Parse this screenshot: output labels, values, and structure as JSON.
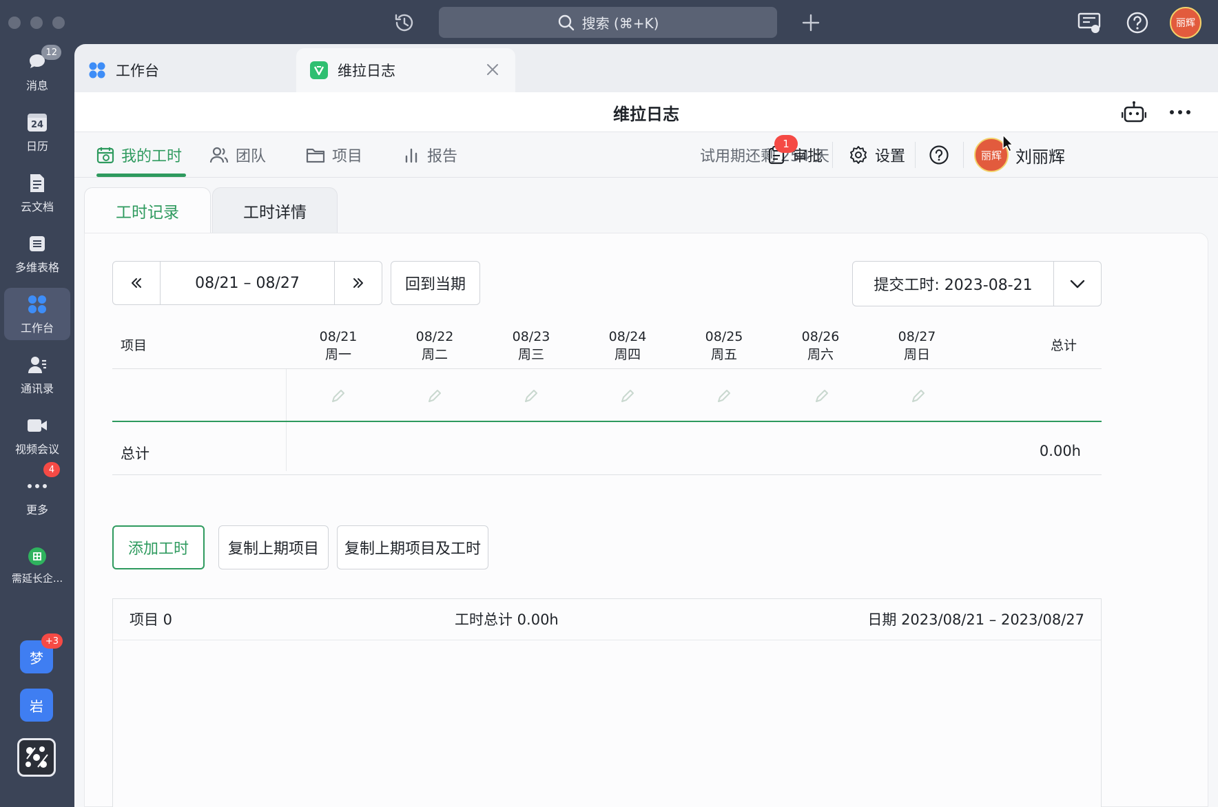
{
  "titlebar": {
    "search_placeholder": "搜索 (⌘+K)",
    "avatar_text": "丽辉"
  },
  "sidebar": {
    "items": [
      {
        "label": "消息",
        "badge": "12"
      },
      {
        "label": "日历",
        "icon_text": "24"
      },
      {
        "label": "云文档"
      },
      {
        "label": "多维表格"
      },
      {
        "label": "工作台"
      },
      {
        "label": "通讯录"
      },
      {
        "label": "视频会议"
      },
      {
        "label": "更多",
        "badge": "4"
      },
      {
        "label": "需延长企..."
      }
    ],
    "apps": [
      {
        "label": "梦",
        "badge": "+3"
      },
      {
        "label": "岩"
      }
    ]
  },
  "tabs": [
    {
      "label": "工作台"
    },
    {
      "label": "维拉日志"
    }
  ],
  "header": {
    "title": "维拉日志"
  },
  "nav": {
    "items": [
      {
        "label": "我的工时"
      },
      {
        "label": "团队"
      },
      {
        "label": "项目"
      },
      {
        "label": "报告"
      }
    ],
    "trial_text": "试用期还剩 254 天",
    "approval_label": "审批",
    "approval_badge": "1",
    "settings_label": "设置",
    "user_avatar_text": "丽辉",
    "user_name": "刘丽辉"
  },
  "subtabs": [
    {
      "label": "工时记录"
    },
    {
      "label": "工时详情"
    }
  ],
  "controls": {
    "range": "08/21 – 08/27",
    "back_to_current": "回到当期",
    "submit": "提交工时: 2023-08-21"
  },
  "table": {
    "project_header": "项目",
    "days": [
      {
        "date": "08/21",
        "weekday": "周一"
      },
      {
        "date": "08/22",
        "weekday": "周二"
      },
      {
        "date": "08/23",
        "weekday": "周三"
      },
      {
        "date": "08/24",
        "weekday": "周四"
      },
      {
        "date": "08/25",
        "weekday": "周五"
      },
      {
        "date": "08/26",
        "weekday": "周六"
      },
      {
        "date": "08/27",
        "weekday": "周日"
      }
    ],
    "total_header": "总计",
    "total_label": "总计",
    "total_value": "0.00h"
  },
  "actions": {
    "add": "添加工时",
    "copy_projects": "复制上期项目",
    "copy_projects_hours": "复制上期项目及工时"
  },
  "summary": {
    "projects": "项目 0",
    "hours_total": "工时总计 0.00h",
    "date_range": "日期 2023/08/21 – 2023/08/27"
  },
  "colors": {
    "accent": "#2e9a5e",
    "badge": "#f54a45",
    "chrome": "#3b4457"
  }
}
